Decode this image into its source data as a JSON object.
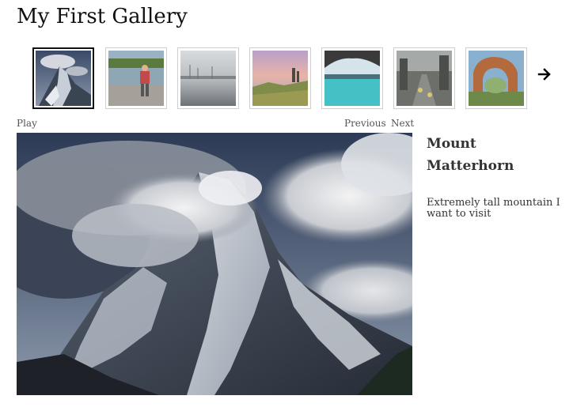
{
  "gallery": {
    "title": "My First Gallery"
  },
  "thumbnails": [
    {
      "name": "matterhorn-thumb",
      "selected": true
    },
    {
      "name": "hiker-lake-thumb",
      "selected": false
    },
    {
      "name": "misty-lake-thumb",
      "selected": false
    },
    {
      "name": "coastal-cliffs-thumb",
      "selected": false
    },
    {
      "name": "blue-lagoon-cave-thumb",
      "selected": false
    },
    {
      "name": "city-street-thumb",
      "selected": false
    },
    {
      "name": "rock-arch-thumb",
      "selected": false
    }
  ],
  "controls": {
    "play": "Play",
    "previous": "Previous",
    "next": "Next",
    "next_arrow_icon": "arrow-right-icon"
  },
  "caption": {
    "title": "Mount Matterhorn",
    "description": "Extremely tall mountain I want to visit"
  }
}
